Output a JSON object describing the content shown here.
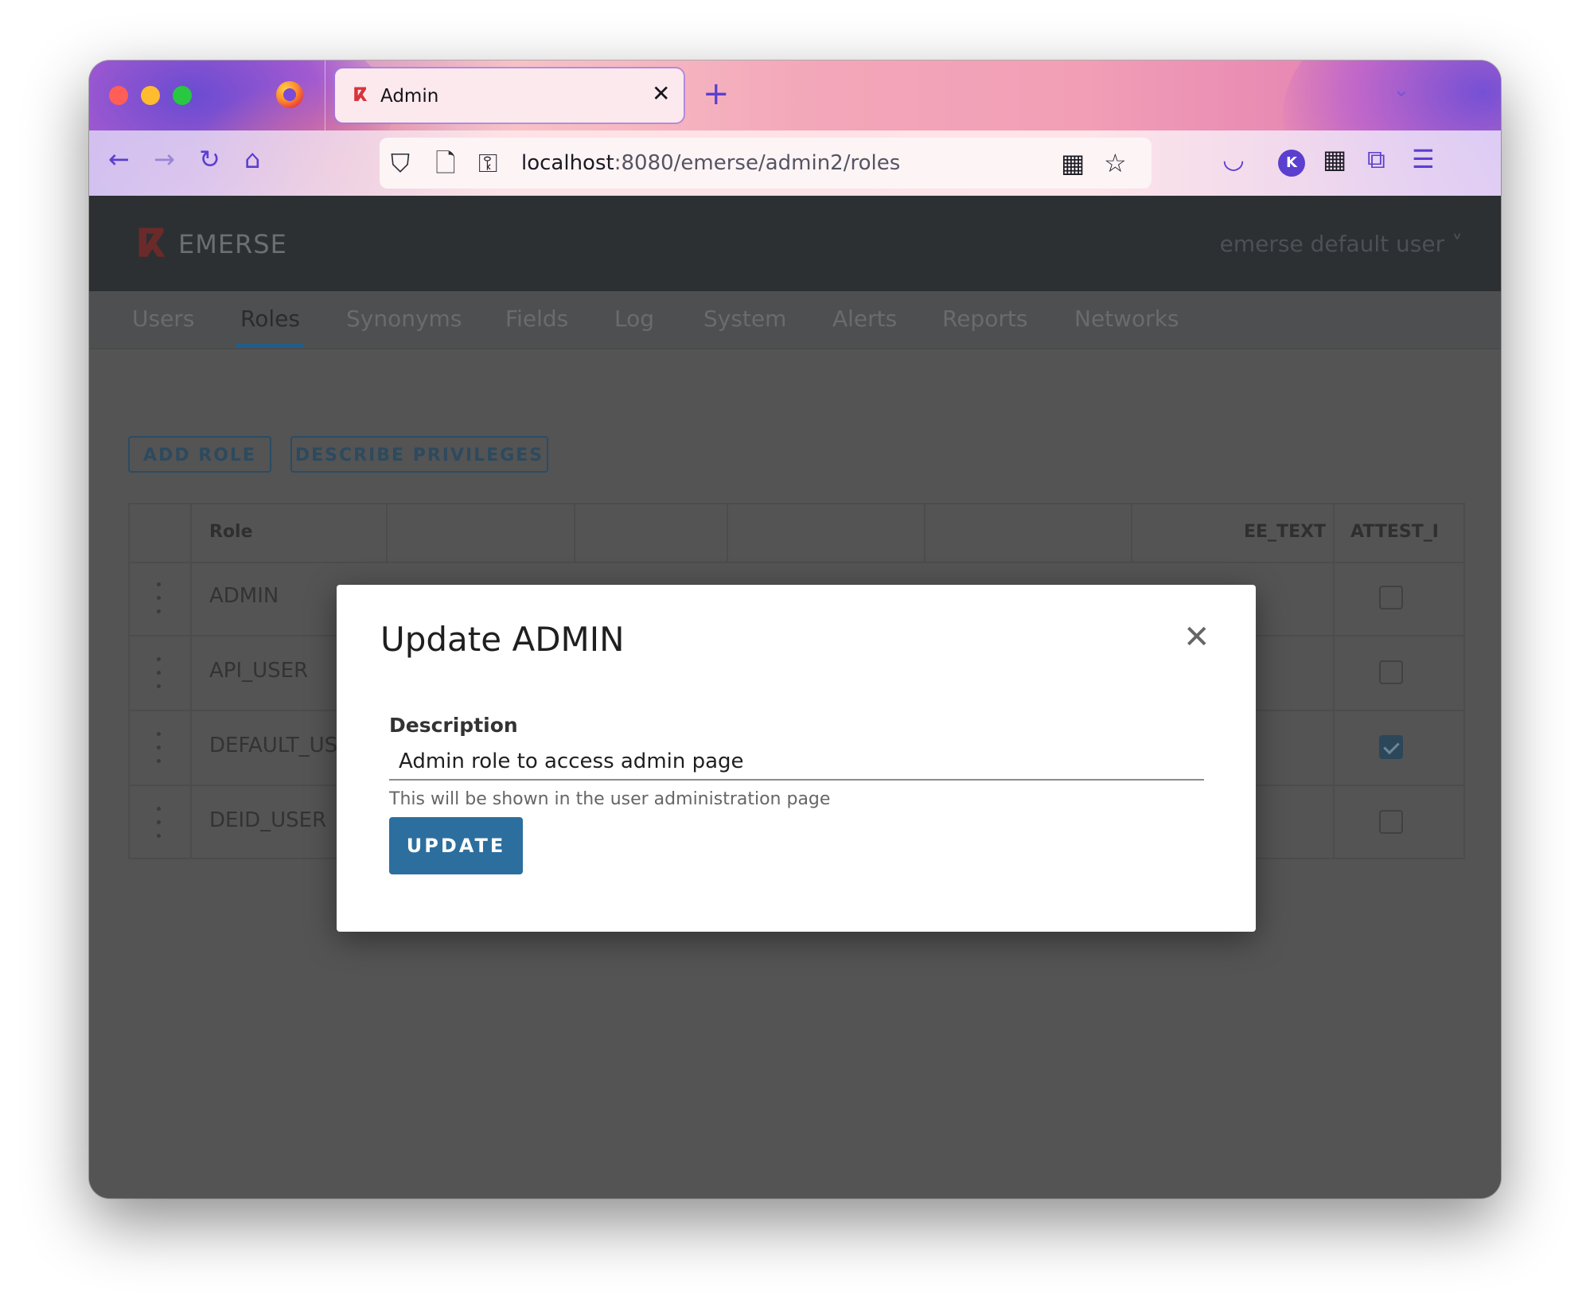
{
  "browser": {
    "tab_title": "Admin",
    "tab_close_icon": "✕",
    "new_tab_icon": "+",
    "tab_list_icon": "⌄",
    "url_host": "localhost",
    "url_path": ":8080/emerse/admin2/roles",
    "nav": {
      "back": "←",
      "forward": "→",
      "reload": "↻",
      "home": "⌂"
    },
    "icons": {
      "shield": "⛉",
      "page": "🗋",
      "key": "⚿",
      "qr": "▦",
      "bookmark": "☆",
      "pocket": "◡",
      "extensions_add": "▦",
      "extensions": "⧉",
      "menu": "☰"
    },
    "profile_initial": "K"
  },
  "app": {
    "logo_mark": "ⴽ",
    "logo_text": "EMERSE",
    "user_menu": "emerse default user ˅",
    "nav_tabs": [
      "Users",
      "Roles",
      "Synonyms",
      "Fields",
      "Log",
      "System",
      "Alerts",
      "Reports",
      "Networks"
    ],
    "active_tab": "Roles",
    "buttons": {
      "add_role": "ADD ROLE",
      "describe_privileges": "DESCRIBE PRIVILEGES"
    },
    "grid": {
      "headers": {
        "role": "Role",
        "free_text_partial": "EE_TEXT",
        "attest_partial": "ATTEST_I"
      },
      "rows": [
        {
          "role": "ADMIN",
          "attest_checked": false
        },
        {
          "role": "API_USER",
          "attest_checked": false
        },
        {
          "role": "DEFAULT_US",
          "attest_checked": true
        },
        {
          "role": "DEID_USER",
          "attest_checked": false
        }
      ]
    }
  },
  "modal": {
    "title": "Update ADMIN",
    "close_icon": "✕",
    "description_label": "Description",
    "description_value": "Admin role to access admin page",
    "hint": "This will be shown in the user administration page",
    "update_button": "UPDATE"
  },
  "colors": {
    "primary": "#2c6f9e",
    "app_bar": "#2c3033",
    "overlay_bg": "#545454",
    "tab_accent": "#5b3fcf"
  }
}
